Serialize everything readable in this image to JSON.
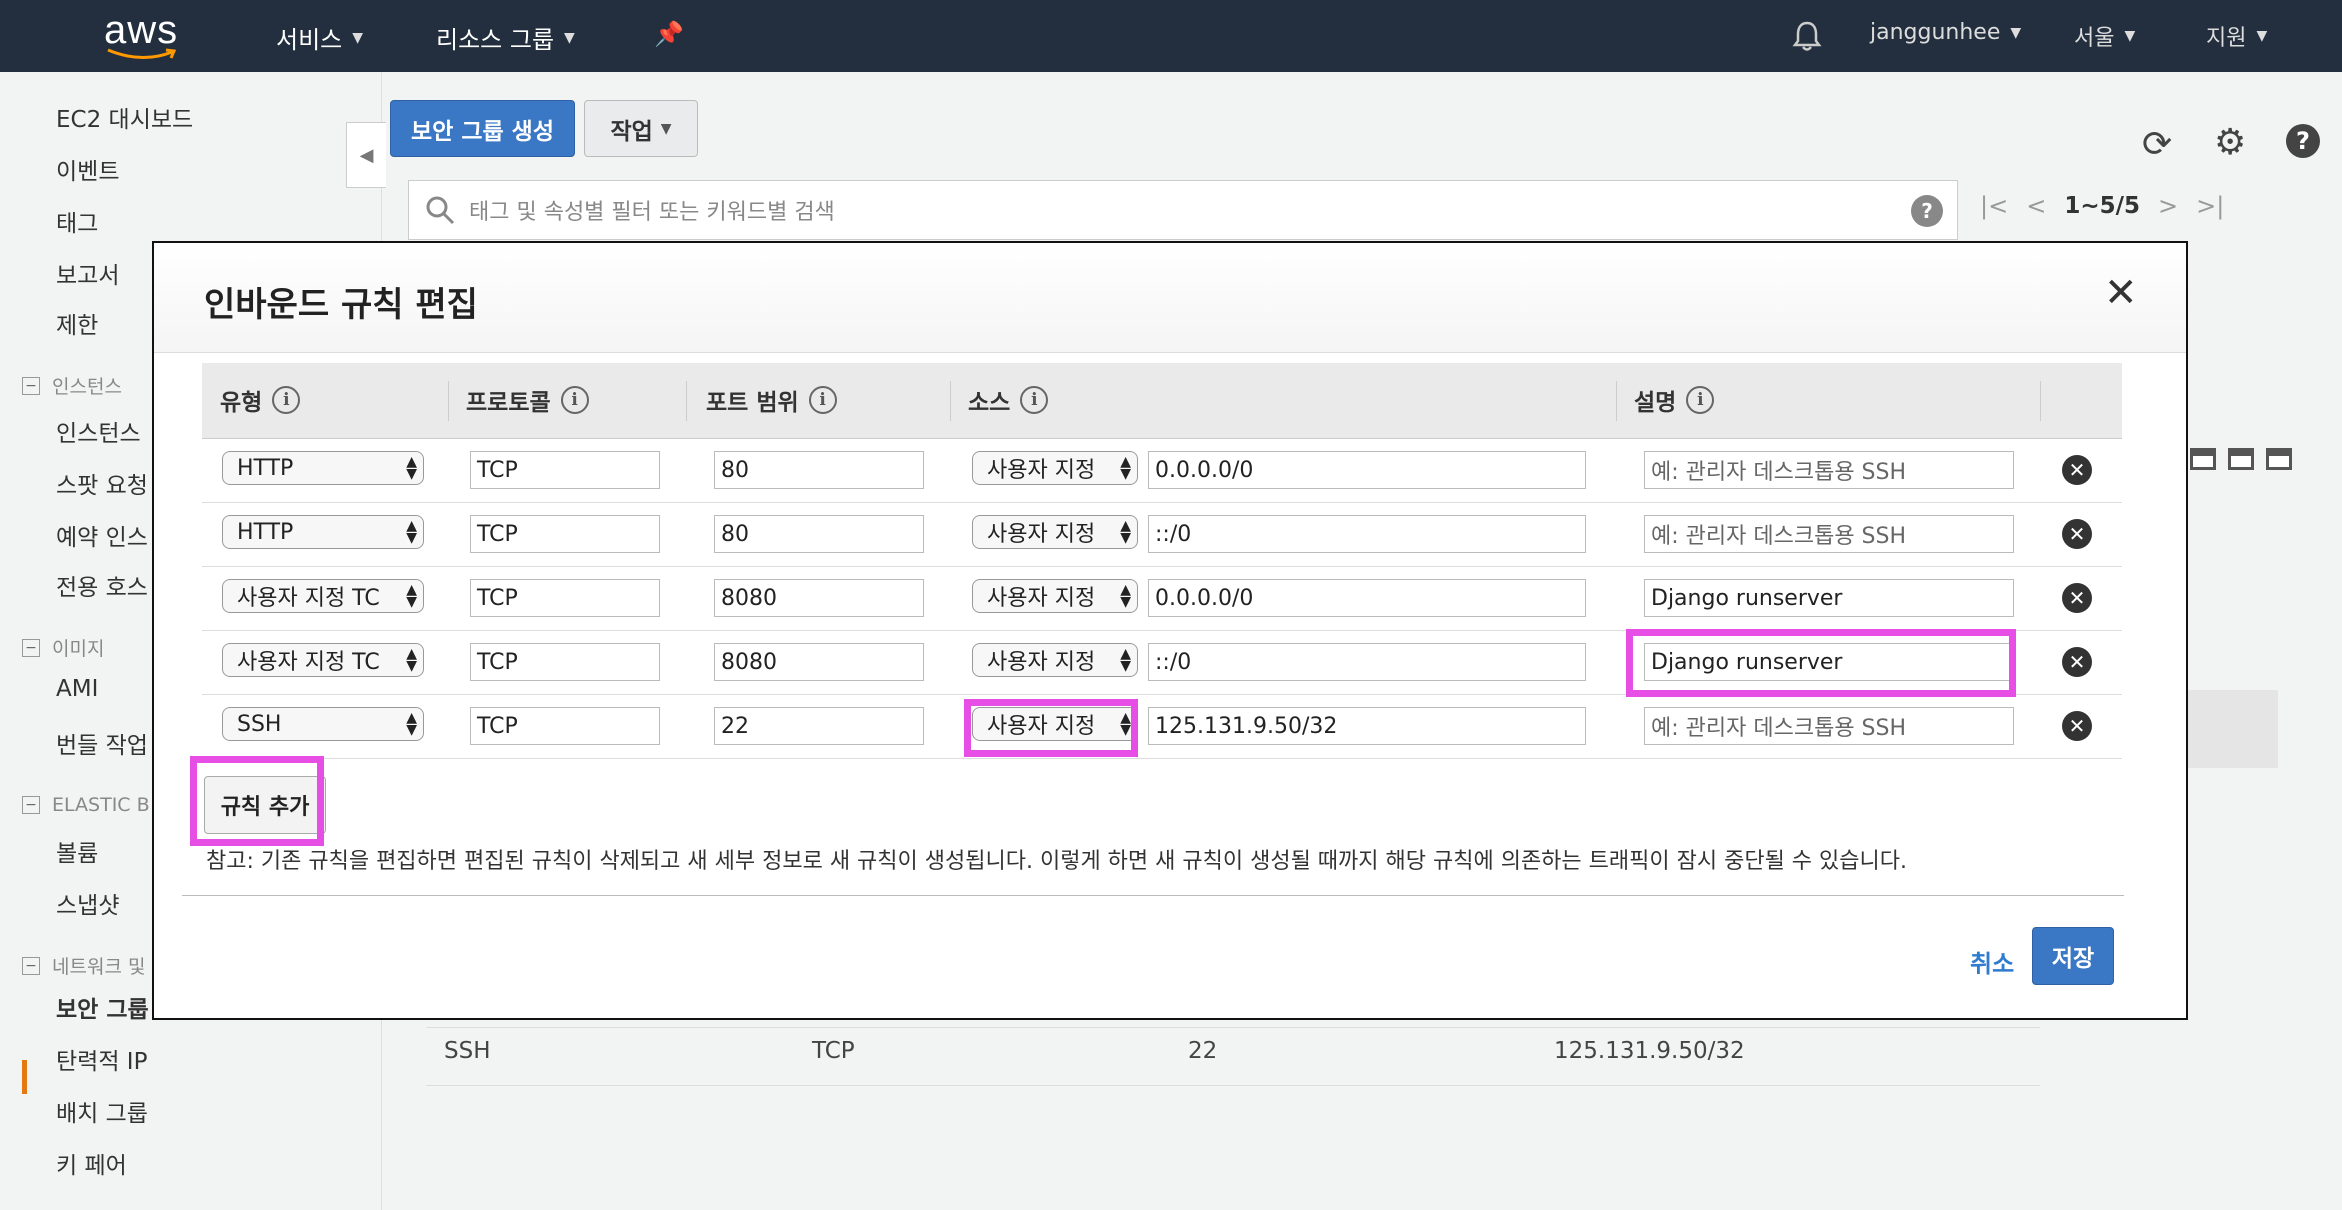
{
  "topnav": {
    "logo": "aws",
    "services": "서비스",
    "resource_groups": "리소스 그룹",
    "user": "janggunhee",
    "region": "서울",
    "support": "지원"
  },
  "sidebar": {
    "items": [
      "EC2 대시보드",
      "이벤트",
      "태그",
      "보고서",
      "제한"
    ],
    "instances_section": "인스턴스",
    "instances_items": [
      "인스턴스",
      "스팟 요청",
      "예약 인스",
      "전용 호스"
    ],
    "images_section": "이미지",
    "images_items": [
      "AMI",
      "번들 작업"
    ],
    "ebs_section": "ELASTIC B",
    "ebs_items": [
      "볼륨",
      "스냅샷"
    ],
    "network_section": "네트워크 및",
    "network_items": [
      "보안 그룹",
      "탄력적 IP",
      "배치 그룹",
      "키 페어"
    ]
  },
  "main": {
    "create_button": "보안 그룹 생성",
    "actions_button": "작업",
    "search_placeholder": "태그 및 속성별 필터 또는 키워드별 검색",
    "pagination": "1~5/5",
    "bg_row": {
      "type": "SSH",
      "protocol": "TCP",
      "port": "22",
      "source": "125.131.9.50/32"
    }
  },
  "modal": {
    "title": "인바운드 규칙 편집",
    "headers": {
      "type": "유형",
      "protocol": "프로토콜",
      "port": "포트 범위",
      "source": "소스",
      "description": "설명"
    },
    "description_placeholder": "예: 관리자 데스크톱용 SSH",
    "rules": [
      {
        "type": "HTTP",
        "protocol": "TCP",
        "port": "80",
        "source_type": "사용자 지정",
        "source": "0.0.0.0/0",
        "description": ""
      },
      {
        "type": "HTTP",
        "protocol": "TCP",
        "port": "80",
        "source_type": "사용자 지정",
        "source": "::/0",
        "description": ""
      },
      {
        "type": "사용자 지정 TC",
        "protocol": "TCP",
        "port": "8080",
        "source_type": "사용자 지정",
        "source": "0.0.0.0/0",
        "description": "Django runserver"
      },
      {
        "type": "사용자 지정 TC",
        "protocol": "TCP",
        "port": "8080",
        "source_type": "사용자 지정",
        "source": "::/0",
        "description": "Django runserver"
      },
      {
        "type": "SSH",
        "protocol": "TCP",
        "port": "22",
        "source_type": "사용자 지정",
        "source": "125.131.9.50/32",
        "description": ""
      }
    ],
    "add_rule": "규칙 추가",
    "note": "참고: 기존 규칙을 편집하면 편집된 규칙이 삭제되고 새 세부 정보로 새 규칙이 생성됩니다. 이렇게 하면 새 규칙이 생성될 때까지 해당 규칙에 의존하는 트래픽이 잠시 중단될 수 있습니다.",
    "cancel": "취소",
    "save": "저장"
  },
  "highlight_color": "#e64ee6"
}
